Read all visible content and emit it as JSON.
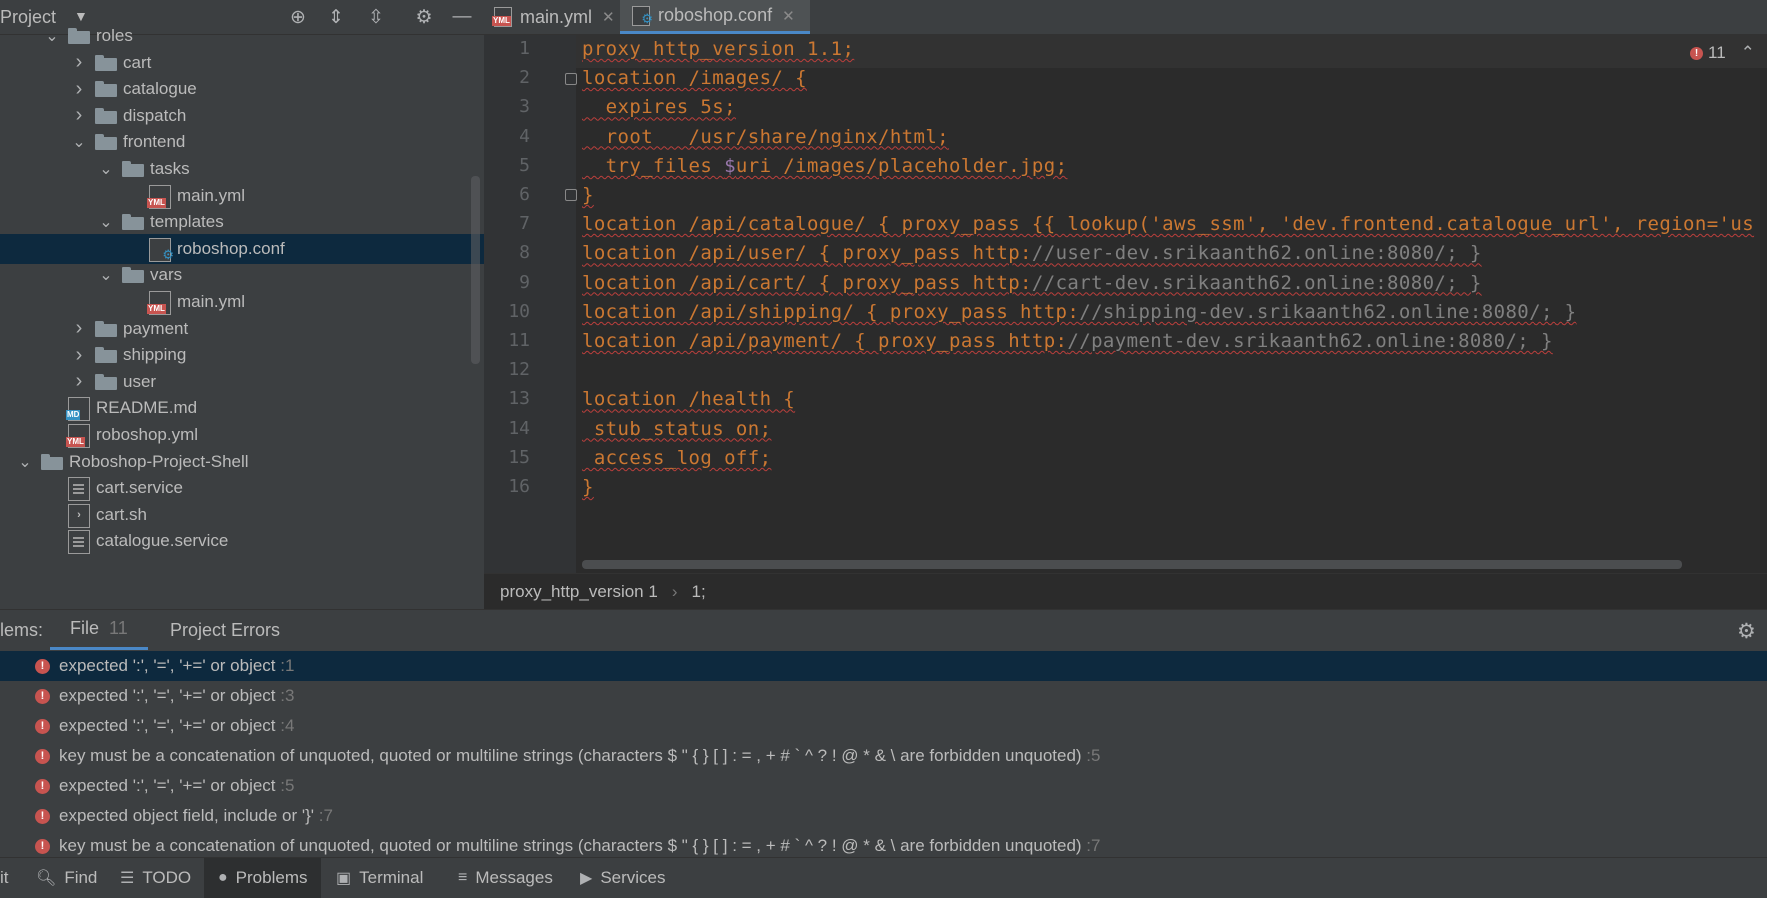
{
  "project": {
    "title": "Project",
    "tree": [
      {
        "label": "roles",
        "type": "folder",
        "expanded": true
      },
      {
        "label": "cart",
        "type": "folder",
        "expanded": false
      },
      {
        "label": "catalogue",
        "type": "folder",
        "expanded": false
      },
      {
        "label": "dispatch",
        "type": "folder",
        "expanded": false
      },
      {
        "label": "frontend",
        "type": "folder",
        "expanded": true
      },
      {
        "label": "tasks",
        "type": "folder",
        "expanded": true
      },
      {
        "label": "main.yml",
        "type": "yml"
      },
      {
        "label": "templates",
        "type": "folder",
        "expanded": true
      },
      {
        "label": "roboshop.conf",
        "type": "conf",
        "selected": true
      },
      {
        "label": "vars",
        "type": "folder",
        "expanded": true
      },
      {
        "label": "main.yml",
        "type": "yml"
      },
      {
        "label": "payment",
        "type": "folder",
        "expanded": false
      },
      {
        "label": "shipping",
        "type": "folder",
        "expanded": false
      },
      {
        "label": "user",
        "type": "folder",
        "expanded": false
      },
      {
        "label": "README.md",
        "type": "md"
      },
      {
        "label": "roboshop.yml",
        "type": "yml"
      },
      {
        "label": "Roboshop-Project-Shell",
        "type": "folder",
        "expanded": true
      },
      {
        "label": "cart.service",
        "type": "text"
      },
      {
        "label": "cart.sh",
        "type": "sh"
      },
      {
        "label": "catalogue.service",
        "type": "text"
      }
    ]
  },
  "tabs": [
    {
      "label": "main.yml",
      "icon": "yml-file-icon",
      "active": false
    },
    {
      "label": "roboshop.conf",
      "icon": "conf-file-icon",
      "active": true
    }
  ],
  "editor": {
    "error_count": "11",
    "lines": [
      {
        "n": "1",
        "segments": [
          {
            "t": "proxy_http_version 1.1;",
            "c": "kw"
          }
        ]
      },
      {
        "n": "2",
        "segments": [
          {
            "t": "location /images/ {",
            "c": "kw"
          }
        ]
      },
      {
        "n": "3",
        "segments": [
          {
            "t": "  expires 5s;",
            "c": "kw"
          }
        ]
      },
      {
        "n": "4",
        "segments": [
          {
            "t": "  root   /usr/share/nginx/html;",
            "c": "kw"
          }
        ]
      },
      {
        "n": "5",
        "segments": [
          {
            "t": "  try_files ",
            "c": "kw"
          },
          {
            "t": "$",
            "c": "var"
          },
          {
            "t": "uri /images/placeholder.jpg;",
            "c": "kw"
          }
        ]
      },
      {
        "n": "6",
        "segments": [
          {
            "t": "}",
            "c": "kw"
          }
        ]
      },
      {
        "n": "7",
        "segments": [
          {
            "t": "location /api/catalogue/ { proxy_pass {{ lookup('aws_ssm', 'dev.frontend.catalogue_url', region='us",
            "c": "kw"
          }
        ]
      },
      {
        "n": "8",
        "segments": [
          {
            "t": "location /api/user/ { proxy_pass http:",
            "c": "kw"
          },
          {
            "t": "//user-dev.srikaanth62.online:8080/; }",
            "c": "dim"
          }
        ]
      },
      {
        "n": "9",
        "segments": [
          {
            "t": "location /api/cart/ { proxy_pass http:",
            "c": "kw"
          },
          {
            "t": "//cart-dev.srikaanth62.online:8080/; }",
            "c": "dim"
          }
        ]
      },
      {
        "n": "10",
        "segments": [
          {
            "t": "location /api/shipping/ { proxy_pass http:",
            "c": "kw"
          },
          {
            "t": "//shipping-dev.srikaanth62.online:8080/; }",
            "c": "dim"
          }
        ]
      },
      {
        "n": "11",
        "segments": [
          {
            "t": "location /api/payment/ { proxy_pass http:",
            "c": "kw"
          },
          {
            "t": "//payment-dev.srikaanth62.online:8080/; }",
            "c": "dim"
          }
        ]
      },
      {
        "n": "12",
        "segments": [
          {
            "t": "",
            "c": "kw"
          }
        ]
      },
      {
        "n": "13",
        "segments": [
          {
            "t": "location /health {",
            "c": "kw"
          }
        ]
      },
      {
        "n": "14",
        "segments": [
          {
            "t": " stub_status on;",
            "c": "kw"
          }
        ]
      },
      {
        "n": "15",
        "segments": [
          {
            "t": " access_log off;",
            "c": "kw"
          }
        ]
      },
      {
        "n": "16",
        "segments": [
          {
            "t": "}",
            "c": "kw"
          }
        ]
      }
    ]
  },
  "breadcrumb": {
    "part1": "proxy_http_version 1",
    "separator": "›",
    "part2": "1;"
  },
  "problems": {
    "header_label": "lems:",
    "tabs": [
      {
        "label": "File",
        "count": "11",
        "active": true
      },
      {
        "label": "Project Errors",
        "count": "",
        "active": false
      }
    ],
    "items": [
      {
        "text": "expected ':', '=', '+=' or object",
        "line": ":1",
        "selected": true
      },
      {
        "text": "expected ':', '=', '+=' or object",
        "line": ":3"
      },
      {
        "text": "expected ':', '=', '+=' or object",
        "line": ":4"
      },
      {
        "text": "key must be a concatenation of unquoted, quoted or multiline strings (characters $ \" { } [ ] : = , + # ` ^ ? ! @ * & \\ are forbidden unquoted)",
        "line": ":5"
      },
      {
        "text": "expected ':', '=', '+=' or object",
        "line": ":5"
      },
      {
        "text": "expected object field, include or '}'",
        "line": ":7"
      },
      {
        "text": "key must be a concatenation of unquoted, quoted or multiline strings (characters $ \" { } [ ] : = , + # ` ^ ? ! @ * & \\ are forbidden unquoted)",
        "line": ":7"
      }
    ]
  },
  "toolbar": {
    "items": [
      {
        "label": "it",
        "icon": ""
      },
      {
        "label": "Find",
        "icon": "search-icon"
      },
      {
        "label": "TODO",
        "icon": "list-icon"
      },
      {
        "label": "Problems",
        "icon": "problems-icon",
        "active": true
      },
      {
        "label": "Terminal",
        "icon": "terminal-icon"
      },
      {
        "label": "Messages",
        "icon": "messages-icon"
      },
      {
        "label": "Services",
        "icon": "services-icon"
      }
    ]
  }
}
